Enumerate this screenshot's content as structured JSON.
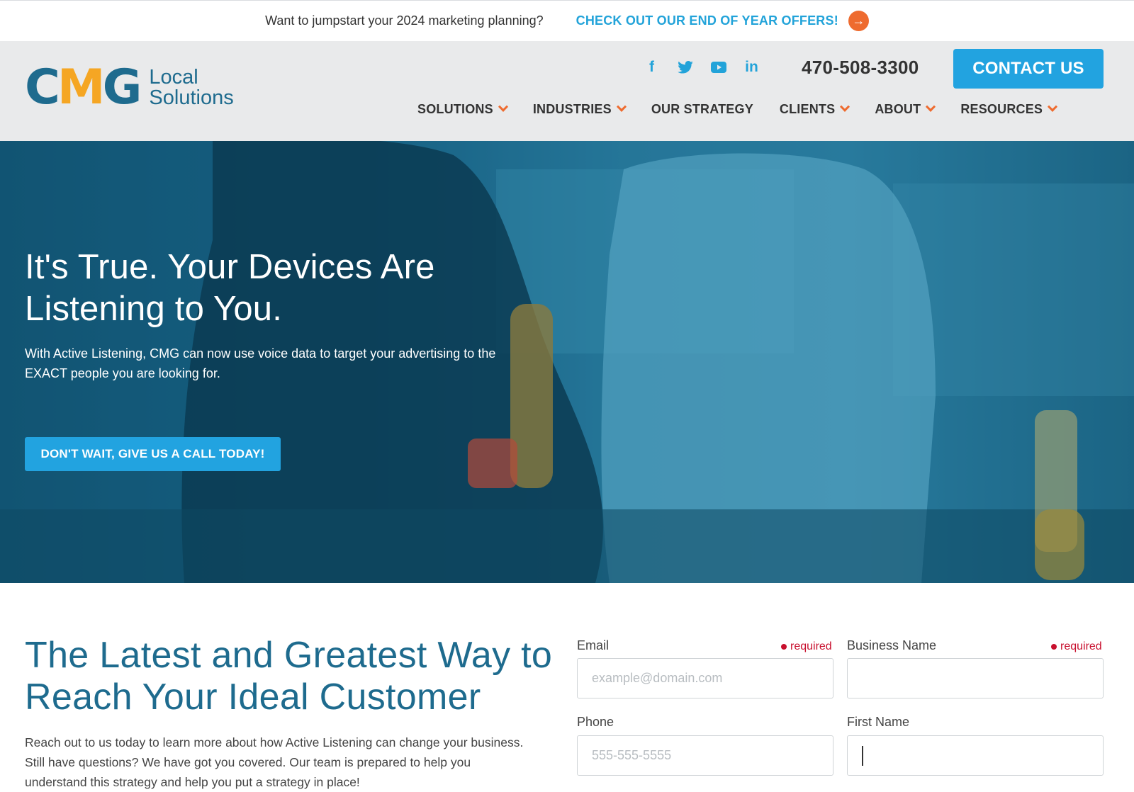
{
  "promo": {
    "text": "Want to jumpstart your 2024 marketing planning?",
    "link": "CHECK OUT OUR END OF YEAR OFFERS!",
    "arrow_icon": "→"
  },
  "header": {
    "logo": {
      "mark_c": "C",
      "mark_m": "M",
      "mark_g": "G",
      "line1": "Local",
      "line2": "Solutions"
    },
    "socials": [
      {
        "name": "facebook-icon",
        "glyph": "f"
      },
      {
        "name": "twitter-icon",
        "glyph": "🐦"
      },
      {
        "name": "youtube-icon",
        "glyph": "▶"
      },
      {
        "name": "linkedin-icon",
        "glyph": "in"
      }
    ],
    "phone": "470-508-3300",
    "contact_label": "CONTACT US",
    "nav": [
      {
        "label": "SOLUTIONS",
        "dropdown": true
      },
      {
        "label": "INDUSTRIES",
        "dropdown": true
      },
      {
        "label": "OUR STRATEGY",
        "dropdown": false
      },
      {
        "label": "CLIENTS",
        "dropdown": true
      },
      {
        "label": "ABOUT",
        "dropdown": true
      },
      {
        "label": "RESOURCES",
        "dropdown": true
      }
    ]
  },
  "hero": {
    "title_line1": "It's True. Your Devices Are",
    "title_line2": "Listening to You.",
    "sub_line1": "With Active Listening, CMG can now use voice data to target your advertising to the",
    "sub_line2": "EXACT people you are looking for.",
    "cta": "DON'T WAIT, GIVE US A CALL TODAY!"
  },
  "lower": {
    "title_line1": "The Latest and Greatest Way to",
    "title_line2": "Reach Your Ideal Customer",
    "text_line1": "Reach out to us today to learn more about how Active Listening can change your business.",
    "text_line2": "Still have questions? We have got you covered. Our team is prepared to help you",
    "text_line3": "understand this strategy and help you put a strategy in place!"
  },
  "form": {
    "email_label": "Email",
    "email_placeholder": "example@domain.com",
    "business_label": "Business Name",
    "phone_label": "Phone",
    "phone_placeholder": "555-555-5555",
    "first_name_label": "First Name",
    "required_text": "required"
  },
  "colors": {
    "accent_blue": "#22a3e0",
    "brand_dark": "#1e6b8e",
    "orange": "#ee6b2f",
    "required_red": "#c8102e"
  }
}
